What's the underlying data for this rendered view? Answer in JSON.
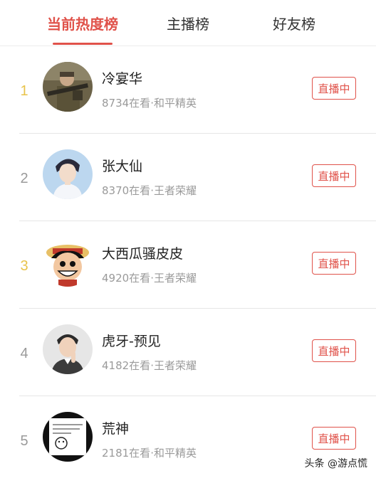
{
  "tabs": [
    {
      "label": "当前热度榜",
      "active": true
    },
    {
      "label": "主播榜",
      "active": false
    },
    {
      "label": "好友榜",
      "active": false
    }
  ],
  "colors": {
    "accent": "#e0524a",
    "rank_first": "#e8c34a",
    "rank_other": "#9a9a9a"
  },
  "list": [
    {
      "rank": "1",
      "name": "冷宴华",
      "viewers": "8734在看",
      "sep": "·",
      "game": "和平精英",
      "button": "直播中",
      "avatar_icon": "soldier-aiming-rifle-avatar"
    },
    {
      "rank": "2",
      "name": "张大仙",
      "viewers": "8370在看",
      "sep": "·",
      "game": "王者荣耀",
      "button": "直播中",
      "avatar_icon": "man-portrait-blue-avatar"
    },
    {
      "rank": "3",
      "name": "大西瓜骚皮皮",
      "viewers": "4920在看",
      "sep": "·",
      "game": "王者荣耀",
      "button": "直播中",
      "avatar_icon": "cartoon-straw-hat-boy-avatar"
    },
    {
      "rank": "4",
      "name": "虎牙-预见",
      "viewers": "4182在看",
      "sep": "·",
      "game": "王者荣耀",
      "button": "直播中",
      "avatar_icon": "man-thinking-portrait-avatar"
    },
    {
      "rank": "5",
      "name": "荒神",
      "viewers": "2181在看",
      "sep": "·",
      "game": "和平精英",
      "button": "直播中",
      "avatar_icon": "meme-sketch-avatar"
    }
  ],
  "watermark": "头条 @游点慌"
}
